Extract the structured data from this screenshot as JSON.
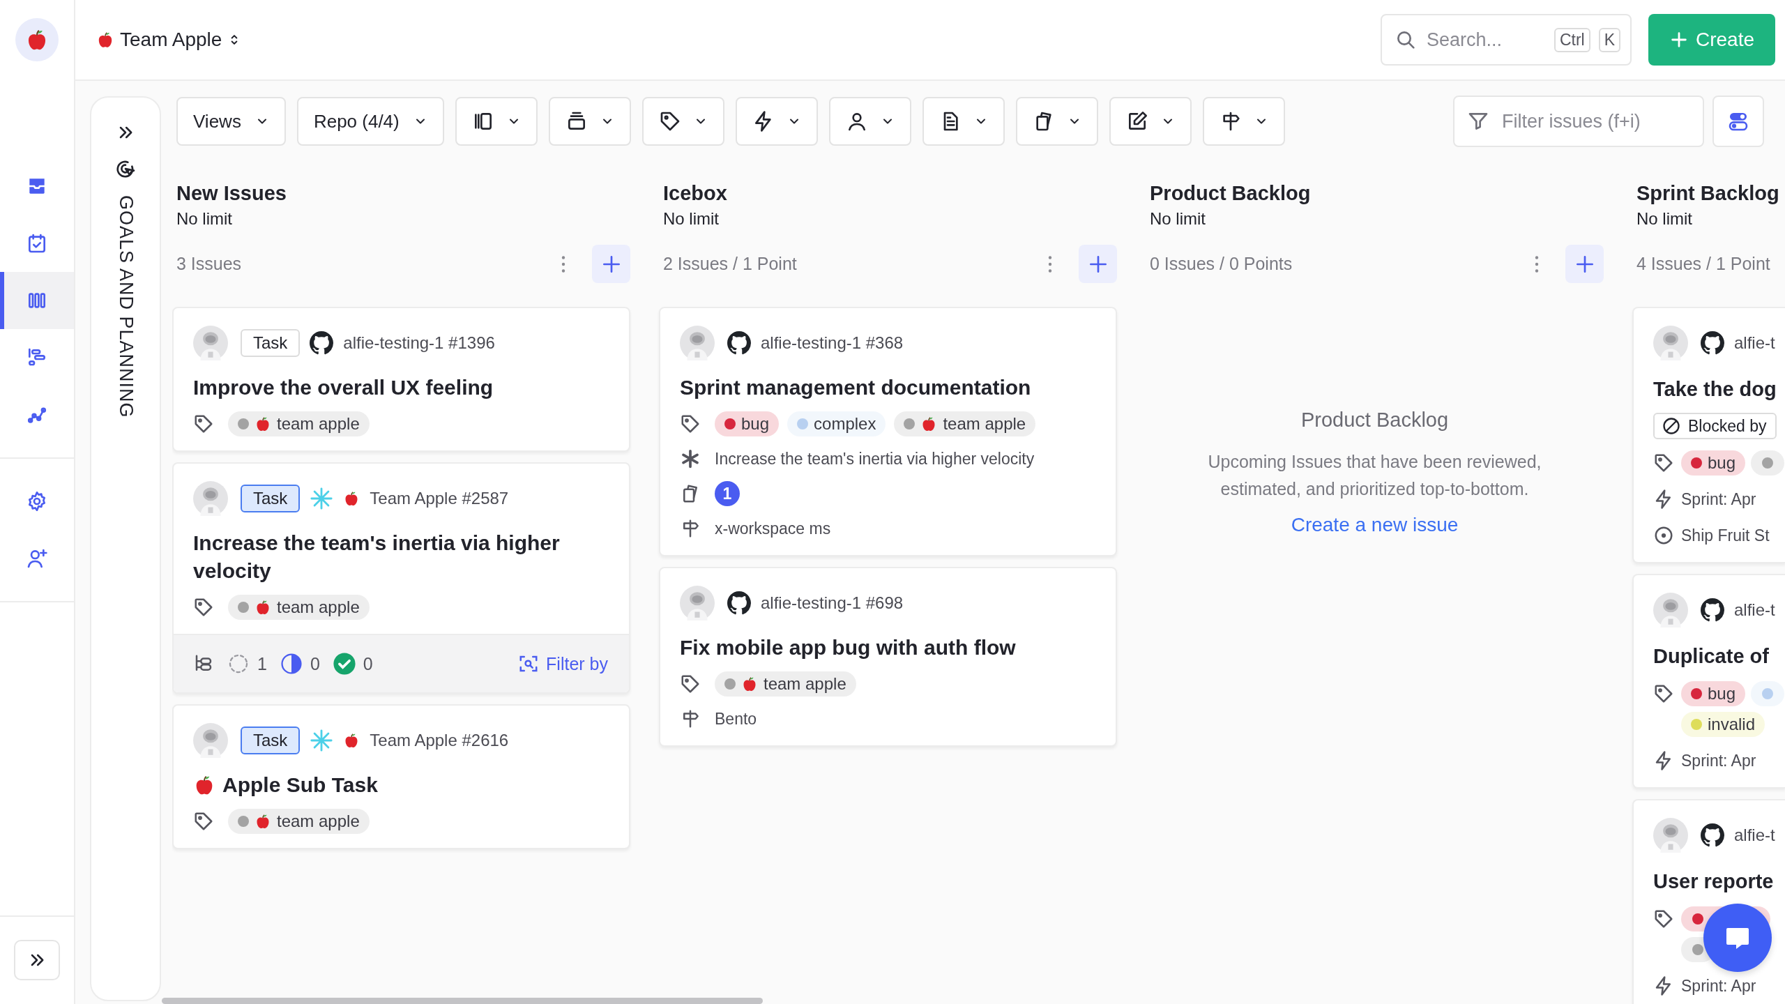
{
  "workspace": {
    "name": "Team Apple"
  },
  "nav": [
    {
      "items": [
        {
          "kind": "inbox",
          "selected": false
        },
        {
          "kind": "calendar",
          "selected": false
        },
        {
          "kind": "board",
          "selected": true
        },
        {
          "kind": "roadmap",
          "selected": false
        },
        {
          "kind": "analytics",
          "selected": false
        }
      ]
    },
    {
      "items": [
        {
          "kind": "settings",
          "selected": false
        },
        {
          "kind": "invite",
          "selected": false
        }
      ]
    }
  ],
  "search": {
    "placeholder": "Search...",
    "keys": [
      "Ctrl",
      "K"
    ]
  },
  "create_button": {
    "label": "Create"
  },
  "goals_panel": {
    "title": "GOALS AND PLANNING"
  },
  "toolbar": {
    "dropdowns": [
      {
        "kind": "text",
        "label": "Views"
      },
      {
        "kind": "text",
        "label": "Repo (4/4)"
      },
      {
        "kind": "layout"
      },
      {
        "kind": "group"
      },
      {
        "kind": "labels"
      },
      {
        "kind": "sprint"
      },
      {
        "kind": "assignee"
      },
      {
        "kind": "document"
      },
      {
        "kind": "cards"
      },
      {
        "kind": "edit"
      },
      {
        "kind": "project"
      }
    ],
    "filter": {
      "placeholder": "Filter issues (f+i)"
    }
  },
  "columns": [
    {
      "title": "New Issues",
      "limit": "No limit",
      "count": "3 Issues",
      "actions": true,
      "cards": [
        {
          "type": {
            "label": "Task",
            "highlighted": false
          },
          "kind": "github",
          "ref": "alfie-testing-1 #1396",
          "title": "Improve the overall UX feeling",
          "tags": [
            {
              "kind": "team",
              "label": "team apple",
              "color": "#a3a3a3"
            }
          ]
        },
        {
          "type": {
            "label": "Task",
            "highlighted": true
          },
          "kind": "team",
          "ref": "Team Apple #2587",
          "title": "Increase the team's inertia via higher velocity",
          "tags": [
            {
              "kind": "team",
              "label": "team apple",
              "color": "#a3a3a3"
            }
          ],
          "sub_issues": [
            {
              "kind": "todo",
              "count": "1"
            },
            {
              "kind": "in_progress",
              "count": "0"
            },
            {
              "kind": "done",
              "count": "0"
            }
          ],
          "filter_link": "Filter by"
        },
        {
          "type": {
            "label": "Task",
            "highlighted": true
          },
          "kind": "team",
          "ref": "Team Apple #2616",
          "title_apple": true,
          "title": "Apple Sub Task",
          "tags": [
            {
              "kind": "team",
              "label": "team apple",
              "color": "#a3a3a3"
            }
          ]
        }
      ]
    },
    {
      "title": "Icebox",
      "limit": "No limit",
      "count": "2 Issues / 1 Point",
      "actions": true,
      "cards": [
        {
          "kind": "github",
          "ref": "alfie-testing-1 #368",
          "title": "Sprint management documentation",
          "tags": [
            {
              "kind": "label",
              "label": "bug",
              "color": "#d7263d"
            },
            {
              "kind": "label",
              "label": "complex",
              "color": "#b8d0f0"
            },
            {
              "kind": "team",
              "label": "team apple",
              "color": "#a3a3a3"
            }
          ],
          "rows": [
            {
              "kind": "parent",
              "text": "Increase the team's inertia via higher velocity"
            },
            {
              "kind": "attachments",
              "count": "1"
            },
            {
              "kind": "project",
              "text": "x-workspace ms"
            }
          ]
        },
        {
          "kind": "github",
          "ref": "alfie-testing-1 #698",
          "title": "Fix mobile app bug with auth flow",
          "tags": [
            {
              "kind": "team",
              "label": "team apple",
              "color": "#a3a3a3"
            }
          ],
          "rows": [
            {
              "kind": "project",
              "text": "Bento"
            }
          ]
        }
      ]
    },
    {
      "title": "Product Backlog",
      "limit": "No limit",
      "count": "0 Issues / 0 Points",
      "actions": true,
      "empty": {
        "title": "Product Backlog",
        "text": "Upcoming Issues that have been reviewed, estimated, and prioritized top-to-bottom.",
        "link": "Create a new issue"
      }
    },
    {
      "title": "Sprint Backlog",
      "limit": "No limit",
      "count": "4 Issues / 1 Point",
      "actions": false,
      "cards": [
        {
          "kind": "github",
          "ref": "alfie-t",
          "title": "Take the dog",
          "blocked": "Blocked by",
          "tags": [
            {
              "kind": "label",
              "label": "bug",
              "color": "#d7263d"
            },
            {
              "kind": "label",
              "color": "#a3a3a3"
            }
          ],
          "rows": [
            {
              "kind": "sprint",
              "text": "Sprint: Apr"
            },
            {
              "kind": "milestone",
              "text": "Ship Fruit St"
            }
          ]
        },
        {
          "kind": "github",
          "ref": "alfie-t",
          "title": "Duplicate of",
          "tags": [
            {
              "kind": "label",
              "label": "bug",
              "color": "#d7263d"
            },
            {
              "kind": "label",
              "color": "#b8d0f0"
            },
            {
              "kind": "label",
              "label": "invalid",
              "color": "#dedd5a"
            }
          ],
          "rows": [
            {
              "kind": "sprint",
              "text": "Sprint: Apr"
            }
          ]
        },
        {
          "kind": "github",
          "ref": "alfie-t",
          "title": "User reporte",
          "tags": [
            {
              "kind": "label",
              "color": "#d7263d"
            },
            {
              "kind": "label",
              "color": "#a3a3a3"
            }
          ],
          "rows": [
            {
              "kind": "sprint",
              "text": "Sprint: Apr"
            }
          ]
        }
      ]
    }
  ]
}
